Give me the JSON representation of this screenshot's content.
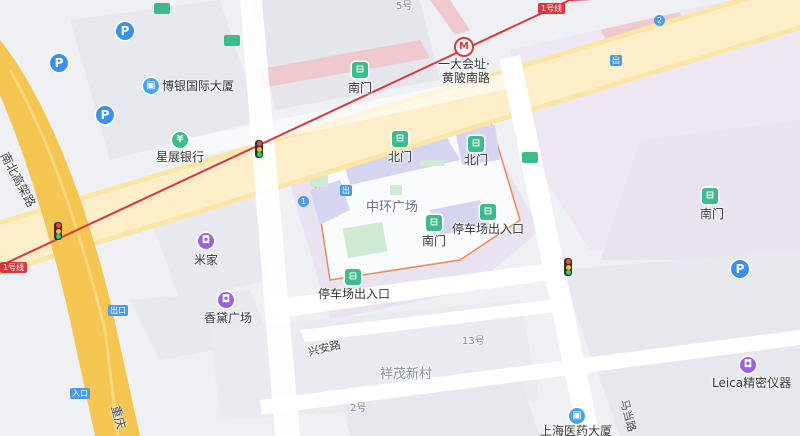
{
  "map": {
    "metro_line": {
      "label": "1号线",
      "color": "#d9363e"
    },
    "metro_line_left_label": "1号线",
    "station": {
      "name_line1": "一大会址·",
      "name_line2": "黄陂南路"
    },
    "exit_tags": [
      "出",
      "出",
      "出口",
      "入口"
    ],
    "exit_numbers": [
      "1",
      "2"
    ],
    "pois": {
      "boyin": "博银国际大厦",
      "xingzhan": "星展银行",
      "nanmen_top": "南门",
      "beimen_1": "北门",
      "beimen_2": "北门",
      "zhonghuan": "中环广场",
      "nanmen_mall": "南门",
      "parking_1": "停车场出入口",
      "parking_2": "停车场出入口",
      "mijia": "米家",
      "xiangdai": "香黛广场",
      "nanmen_right": "南门",
      "leica": "Leica精密仪器",
      "shanghai_yiyao": "上海医药大厦"
    },
    "roads": {
      "nanbei": "南北高架路",
      "chongqing": "重庆",
      "xingan": "兴安路",
      "madang": "马当路",
      "xiangmao": "祥茂新村"
    },
    "house_numbers": {
      "n5": "5号",
      "n13": "13号",
      "n2": "2号"
    },
    "icons": {
      "parking": "P",
      "bank": "¥",
      "office": "office-building-icon",
      "shop": "shopping-bag-icon",
      "gate": "gate-icon",
      "bus": "bus-stop-icon",
      "traffic_light": "traffic-light-icon"
    },
    "colors": {
      "background": "#eef0f4",
      "main_road": "#fbe5a4",
      "highway": "#f4c550",
      "metro": "#d9363e",
      "building": "#dfe1ee",
      "mall": "#e3d5ee"
    }
  }
}
